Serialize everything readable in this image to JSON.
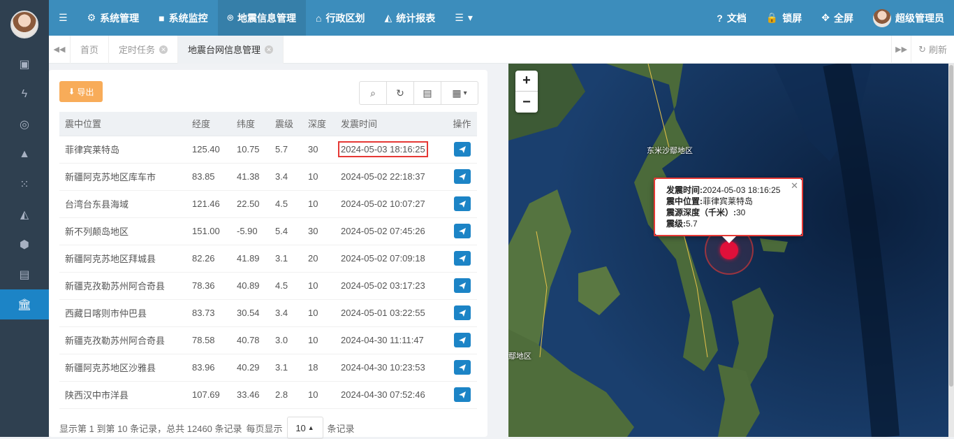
{
  "header": {
    "menu_items": [
      {
        "icon": "gear-icon",
        "label": "系统管理"
      },
      {
        "icon": "video-icon",
        "label": "系统监控"
      },
      {
        "icon": "map-pin-icon",
        "label": "地震信息管理"
      },
      {
        "icon": "institution-icon",
        "label": "行政区划"
      },
      {
        "icon": "area-chart-icon",
        "label": "统计报表"
      }
    ],
    "right_items": [
      {
        "icon": "question-icon",
        "label": "文档"
      },
      {
        "icon": "lock-icon",
        "label": "锁屏"
      },
      {
        "icon": "expand-icon",
        "label": "全屏"
      }
    ],
    "user_name": "超级管理员"
  },
  "tabs": [
    {
      "label": "首页"
    },
    {
      "label": "定时任务"
    },
    {
      "label": "地震台网信息管理"
    }
  ],
  "refresh_label": "刷新",
  "toolbar": {
    "export_label": "导出"
  },
  "table": {
    "headers": [
      "震中位置",
      "经度",
      "纬度",
      "震级",
      "深度",
      "发震时间",
      "操作"
    ],
    "rows": [
      [
        "菲律宾莱特岛",
        "125.40",
        "10.75",
        "5.7",
        "30",
        "2024-05-03 18:16:25"
      ],
      [
        "新疆阿克苏地区库车市",
        "83.85",
        "41.38",
        "3.4",
        "10",
        "2024-05-02 22:18:37"
      ],
      [
        "台湾台东县海域",
        "121.46",
        "22.50",
        "4.5",
        "10",
        "2024-05-02 10:07:27"
      ],
      [
        "新不列颠岛地区",
        "151.00",
        "-5.90",
        "5.4",
        "30",
        "2024-05-02 07:45:26"
      ],
      [
        "新疆阿克苏地区拜城县",
        "82.26",
        "41.89",
        "3.1",
        "20",
        "2024-05-02 07:09:18"
      ],
      [
        "新疆克孜勒苏州阿合奇县",
        "78.36",
        "40.89",
        "4.5",
        "10",
        "2024-05-02 03:17:23"
      ],
      [
        "西藏日喀则市仲巴县",
        "83.73",
        "30.54",
        "3.4",
        "10",
        "2024-05-01 03:22:55"
      ],
      [
        "新疆克孜勒苏州阿合奇县",
        "78.58",
        "40.78",
        "3.0",
        "10",
        "2024-04-30 11:11:47"
      ],
      [
        "新疆阿克苏地区沙雅县",
        "83.96",
        "40.29",
        "3.1",
        "18",
        "2024-04-30 10:23:53"
      ],
      [
        "陕西汉中市洋县",
        "107.69",
        "33.46",
        "2.8",
        "10",
        "2024-04-30 07:52:46"
      ]
    ]
  },
  "pager": {
    "summary": "显示第 1 到第 10 条记录，总共 12460 条记录",
    "per_page_prefix": "每页显示",
    "per_page_value": "10",
    "per_page_suffix": "条记录"
  },
  "map": {
    "labels": [
      "东米沙鄢地区",
      "鄢地区"
    ],
    "popup": {
      "time_label": "发震时间:",
      "time_value": "2024-05-03 18:16:25",
      "location_label": "震中位置:",
      "location_value": "菲律宾莱特岛",
      "depth_label": "震源深度（千米）:",
      "depth_value": "30",
      "magnitude_label": "震级:",
      "magnitude_value": "5.7"
    }
  },
  "colors": {
    "header": "#3c8dbc",
    "sidebar": "#2f4050",
    "primary": "#1c84c6",
    "warning": "#f8ac59",
    "highlight": "#e53935",
    "marker": "#e0103a"
  }
}
